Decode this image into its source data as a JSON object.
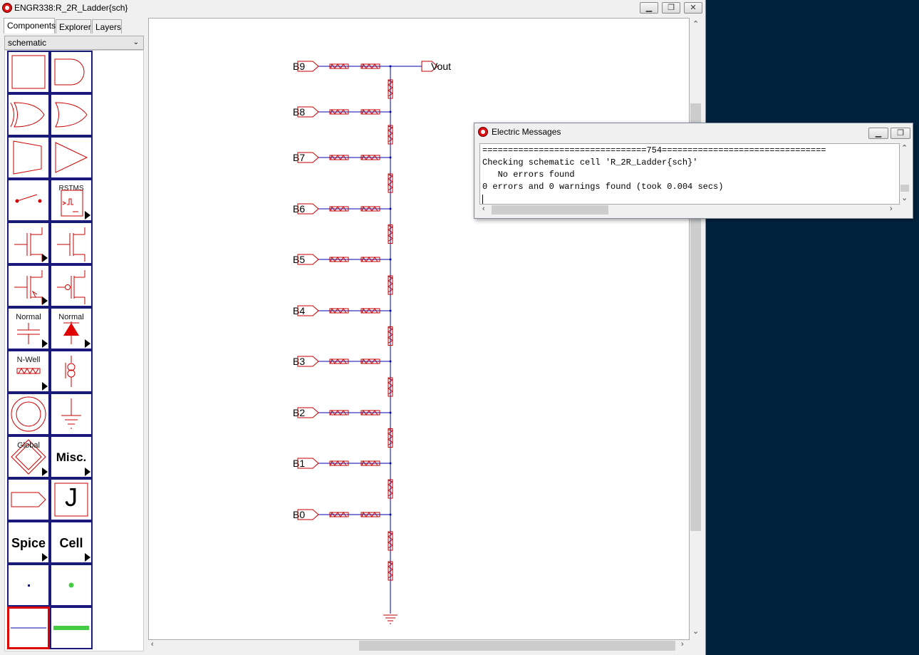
{
  "window": {
    "title": "ENGR338:R_2R_Ladder{sch}"
  },
  "tabs": [
    {
      "label": "Components"
    },
    {
      "label": "Explorer"
    },
    {
      "label": "Layers"
    }
  ],
  "technology_select": {
    "value": "schematic"
  },
  "palette": {
    "cap_label": "Normal",
    "diode_label": "Normal",
    "resistor_label": "N-Well",
    "flipflop_label": "RSTMS",
    "global_label": "Global",
    "misc_label": "Misc.",
    "spice_label": "Spice",
    "cell_label": "Cell",
    "node_letter": "J"
  },
  "schematic": {
    "inputs": [
      "B9",
      "B8",
      "B7",
      "B6",
      "B5",
      "B4",
      "B3",
      "B2",
      "B1",
      "B0"
    ],
    "output": "Vout",
    "colors": {
      "wire": "#0000b0",
      "component": "#c00000",
      "text": "#000000"
    }
  },
  "messages_window": {
    "title": "Electric Messages",
    "lines": [
      "================================754================================",
      "Checking schematic cell 'R_2R_Ladder{sch}'",
      "   No errors found",
      "0 errors and 0 warnings found (took 0.004 secs)"
    ]
  }
}
